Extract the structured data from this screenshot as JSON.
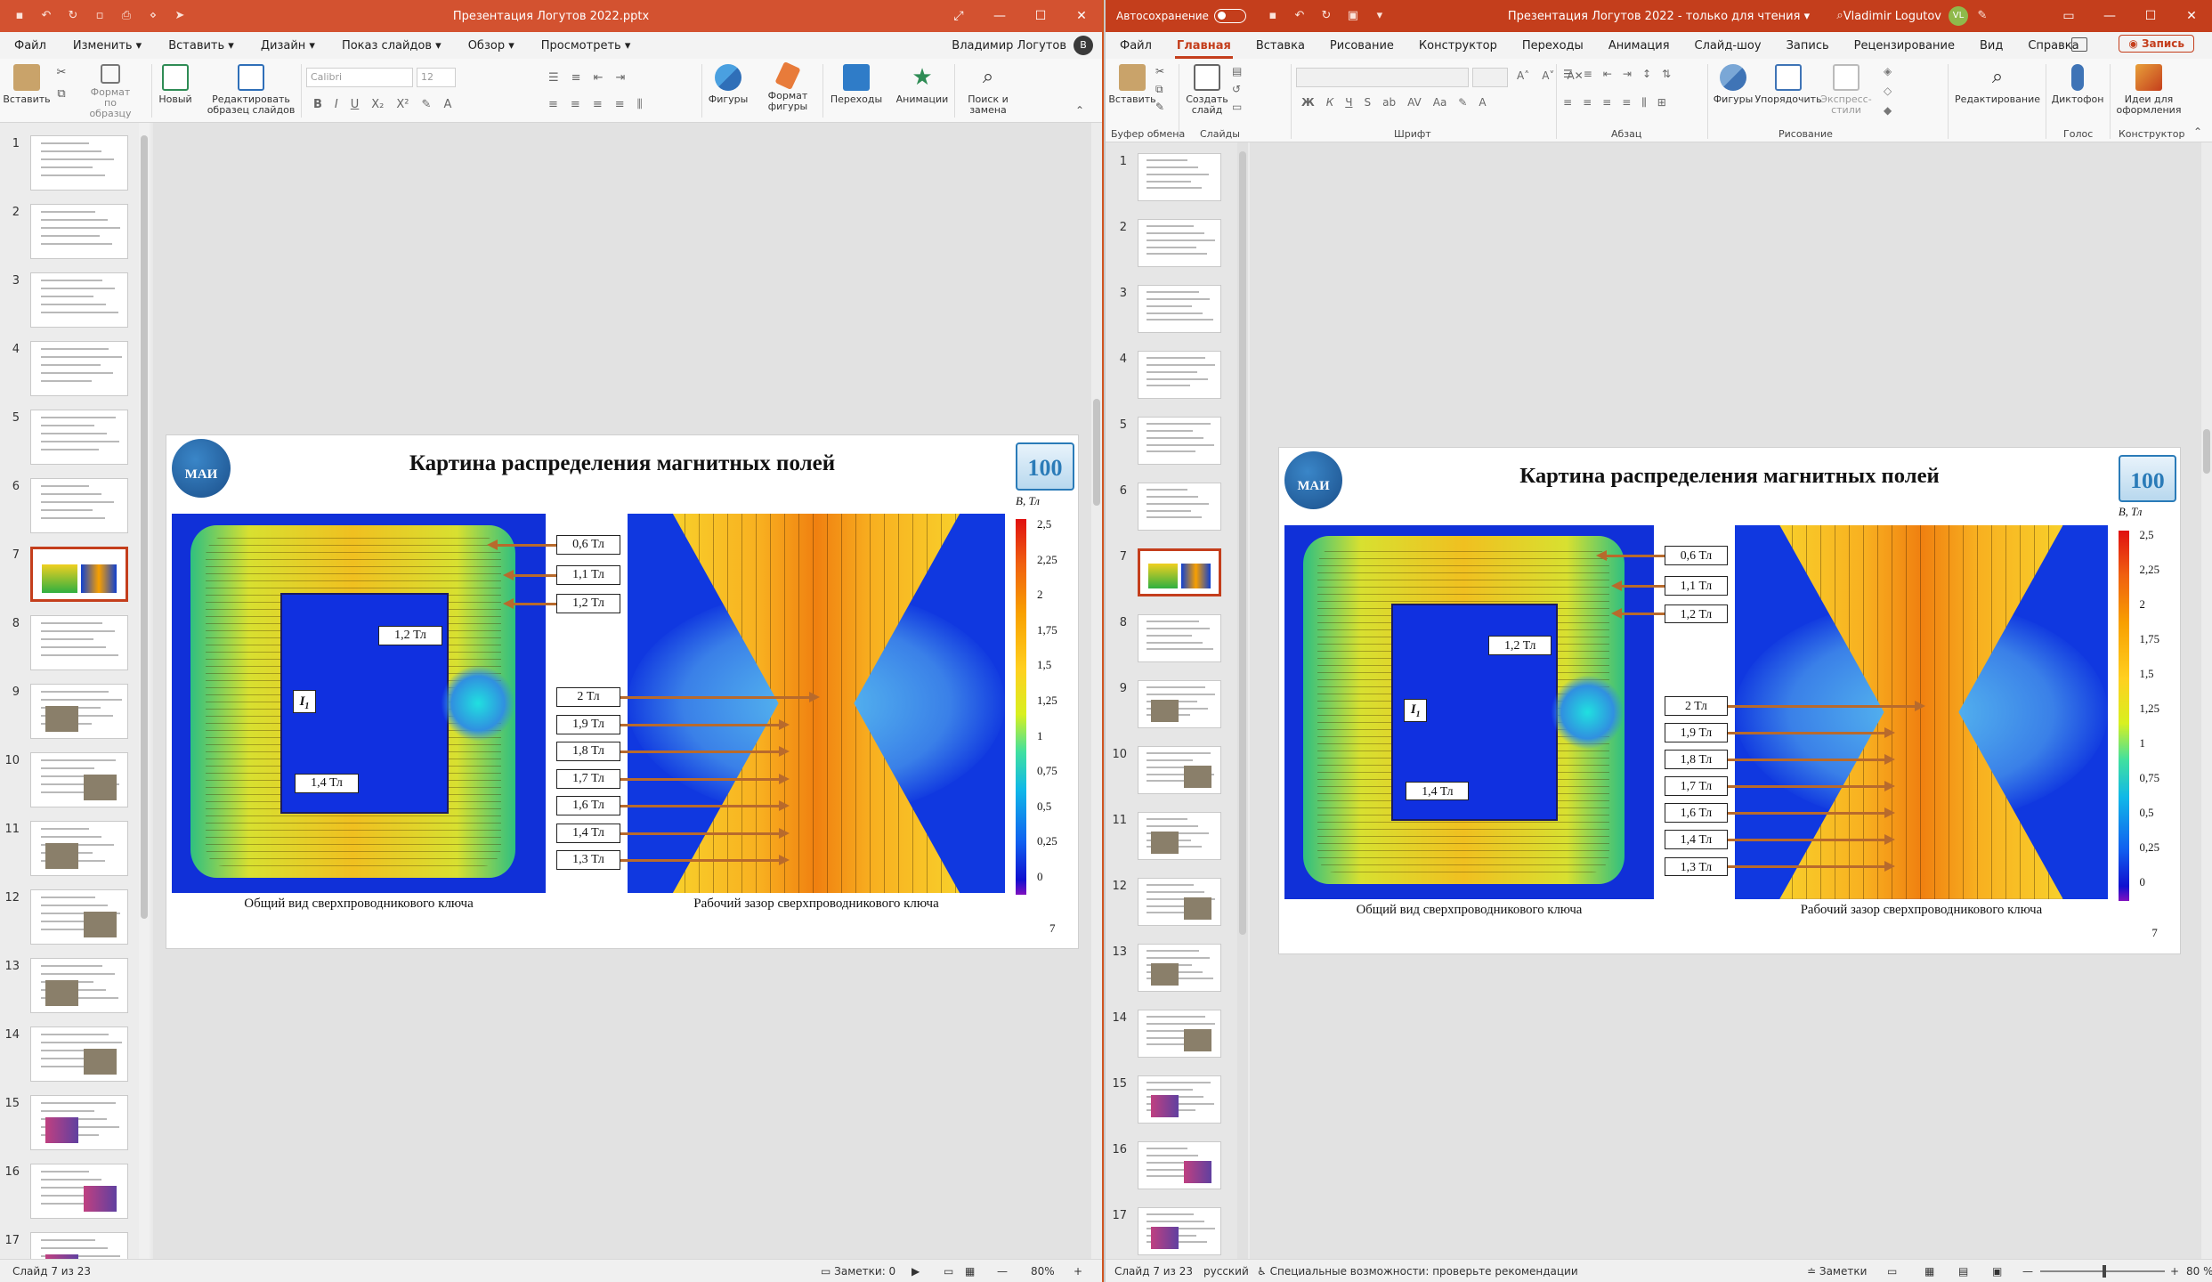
{
  "left_window": {
    "title": "Презентация Логутов 2022.pptx",
    "menu": [
      "Файл",
      "Изменить",
      "Вставить",
      "Дизайн",
      "Показ слайдов",
      "Обзор",
      "Просмотреть"
    ],
    "user": "Владимир Логутов",
    "user_initial": "В",
    "ribbon": {
      "paste": "Вставить",
      "format_painter": "Формат по образцу",
      "new_slide": "Новый",
      "edit_master": "Редактировать образец слайдов",
      "font_name": "Calibri",
      "font_size": "12",
      "shapes": "Фигуры",
      "shape_format": "Формат фигуры",
      "transitions": "Переходы",
      "animations": "Анимации",
      "find_replace": "Поиск и замена"
    },
    "status": {
      "slide_info": "Слайд 7 из 23",
      "notes": "Заметки: 0",
      "zoom": "80%"
    }
  },
  "right_window": {
    "autosave_label": "Автосохранение",
    "title": "Презентация Логутов 2022",
    "read_only": "только для чтения",
    "user": "Vladimir Logutov",
    "user_initials": "VL",
    "menu": [
      "Файл",
      "Главная",
      "Вставка",
      "Рисование",
      "Конструктор",
      "Переходы",
      "Анимация",
      "Слайд-шоу",
      "Запись",
      "Рецензирование",
      "Вид",
      "Справка"
    ],
    "active_tab": "Главная",
    "record_button": "Запись",
    "ribbon": {
      "paste": "Вставить",
      "create_slide": "Создать слайд",
      "shapes": "Фигуры",
      "arrange": "Упорядочить",
      "quick_styles": "Экспресс-стили",
      "editing": "Редактирование",
      "dictation": "Диктофон",
      "designer": "Идеи для оформления",
      "groups": [
        "Буфер обмена",
        "Слайды",
        "Шрифт",
        "Абзац",
        "Рисование",
        "Голос",
        "Конструктор"
      ]
    },
    "status": {
      "slide_info": "Слайд 7 из 23",
      "language": "русский",
      "accessibility": "Специальные возможности: проверьте рекомендации",
      "notes": "Заметки",
      "zoom": "80 %"
    }
  },
  "slide": {
    "title": "Картина распределения магнитных полей",
    "logo_left": "МАИ",
    "logo_right": "100",
    "caption_left": "Общий вид сверхпроводникового ключа",
    "caption_right": "Рабочий зазор сверхпроводникового ключа",
    "current_label": "I",
    "current_sub": "1",
    "labels_core": [
      "0,6 Тл",
      "1,1 Тл",
      "1,2 Тл"
    ],
    "label_inner": "1,2 Тл",
    "label_bottom": "1,4 Тл",
    "labels_gap": [
      "2 Тл",
      "1,9 Тл",
      "1,8 Тл",
      "1,7 Тл",
      "1,6 Тл",
      "1,4 Тл",
      "1,3 Тл"
    ],
    "colorbar_title": "B, Тл",
    "colorbar_ticks": [
      "2,5",
      "2,25",
      "2",
      "1,75",
      "1,5",
      "1,25",
      "1",
      "0,75",
      "0,5",
      "0,25",
      "0"
    ],
    "page_number": "7"
  },
  "thumbnails": [
    "1",
    "2",
    "3",
    "4",
    "5",
    "6",
    "7",
    "8",
    "9",
    "10",
    "11",
    "12",
    "13",
    "14",
    "15",
    "16",
    "17"
  ],
  "selected_thumbnail": "7"
}
